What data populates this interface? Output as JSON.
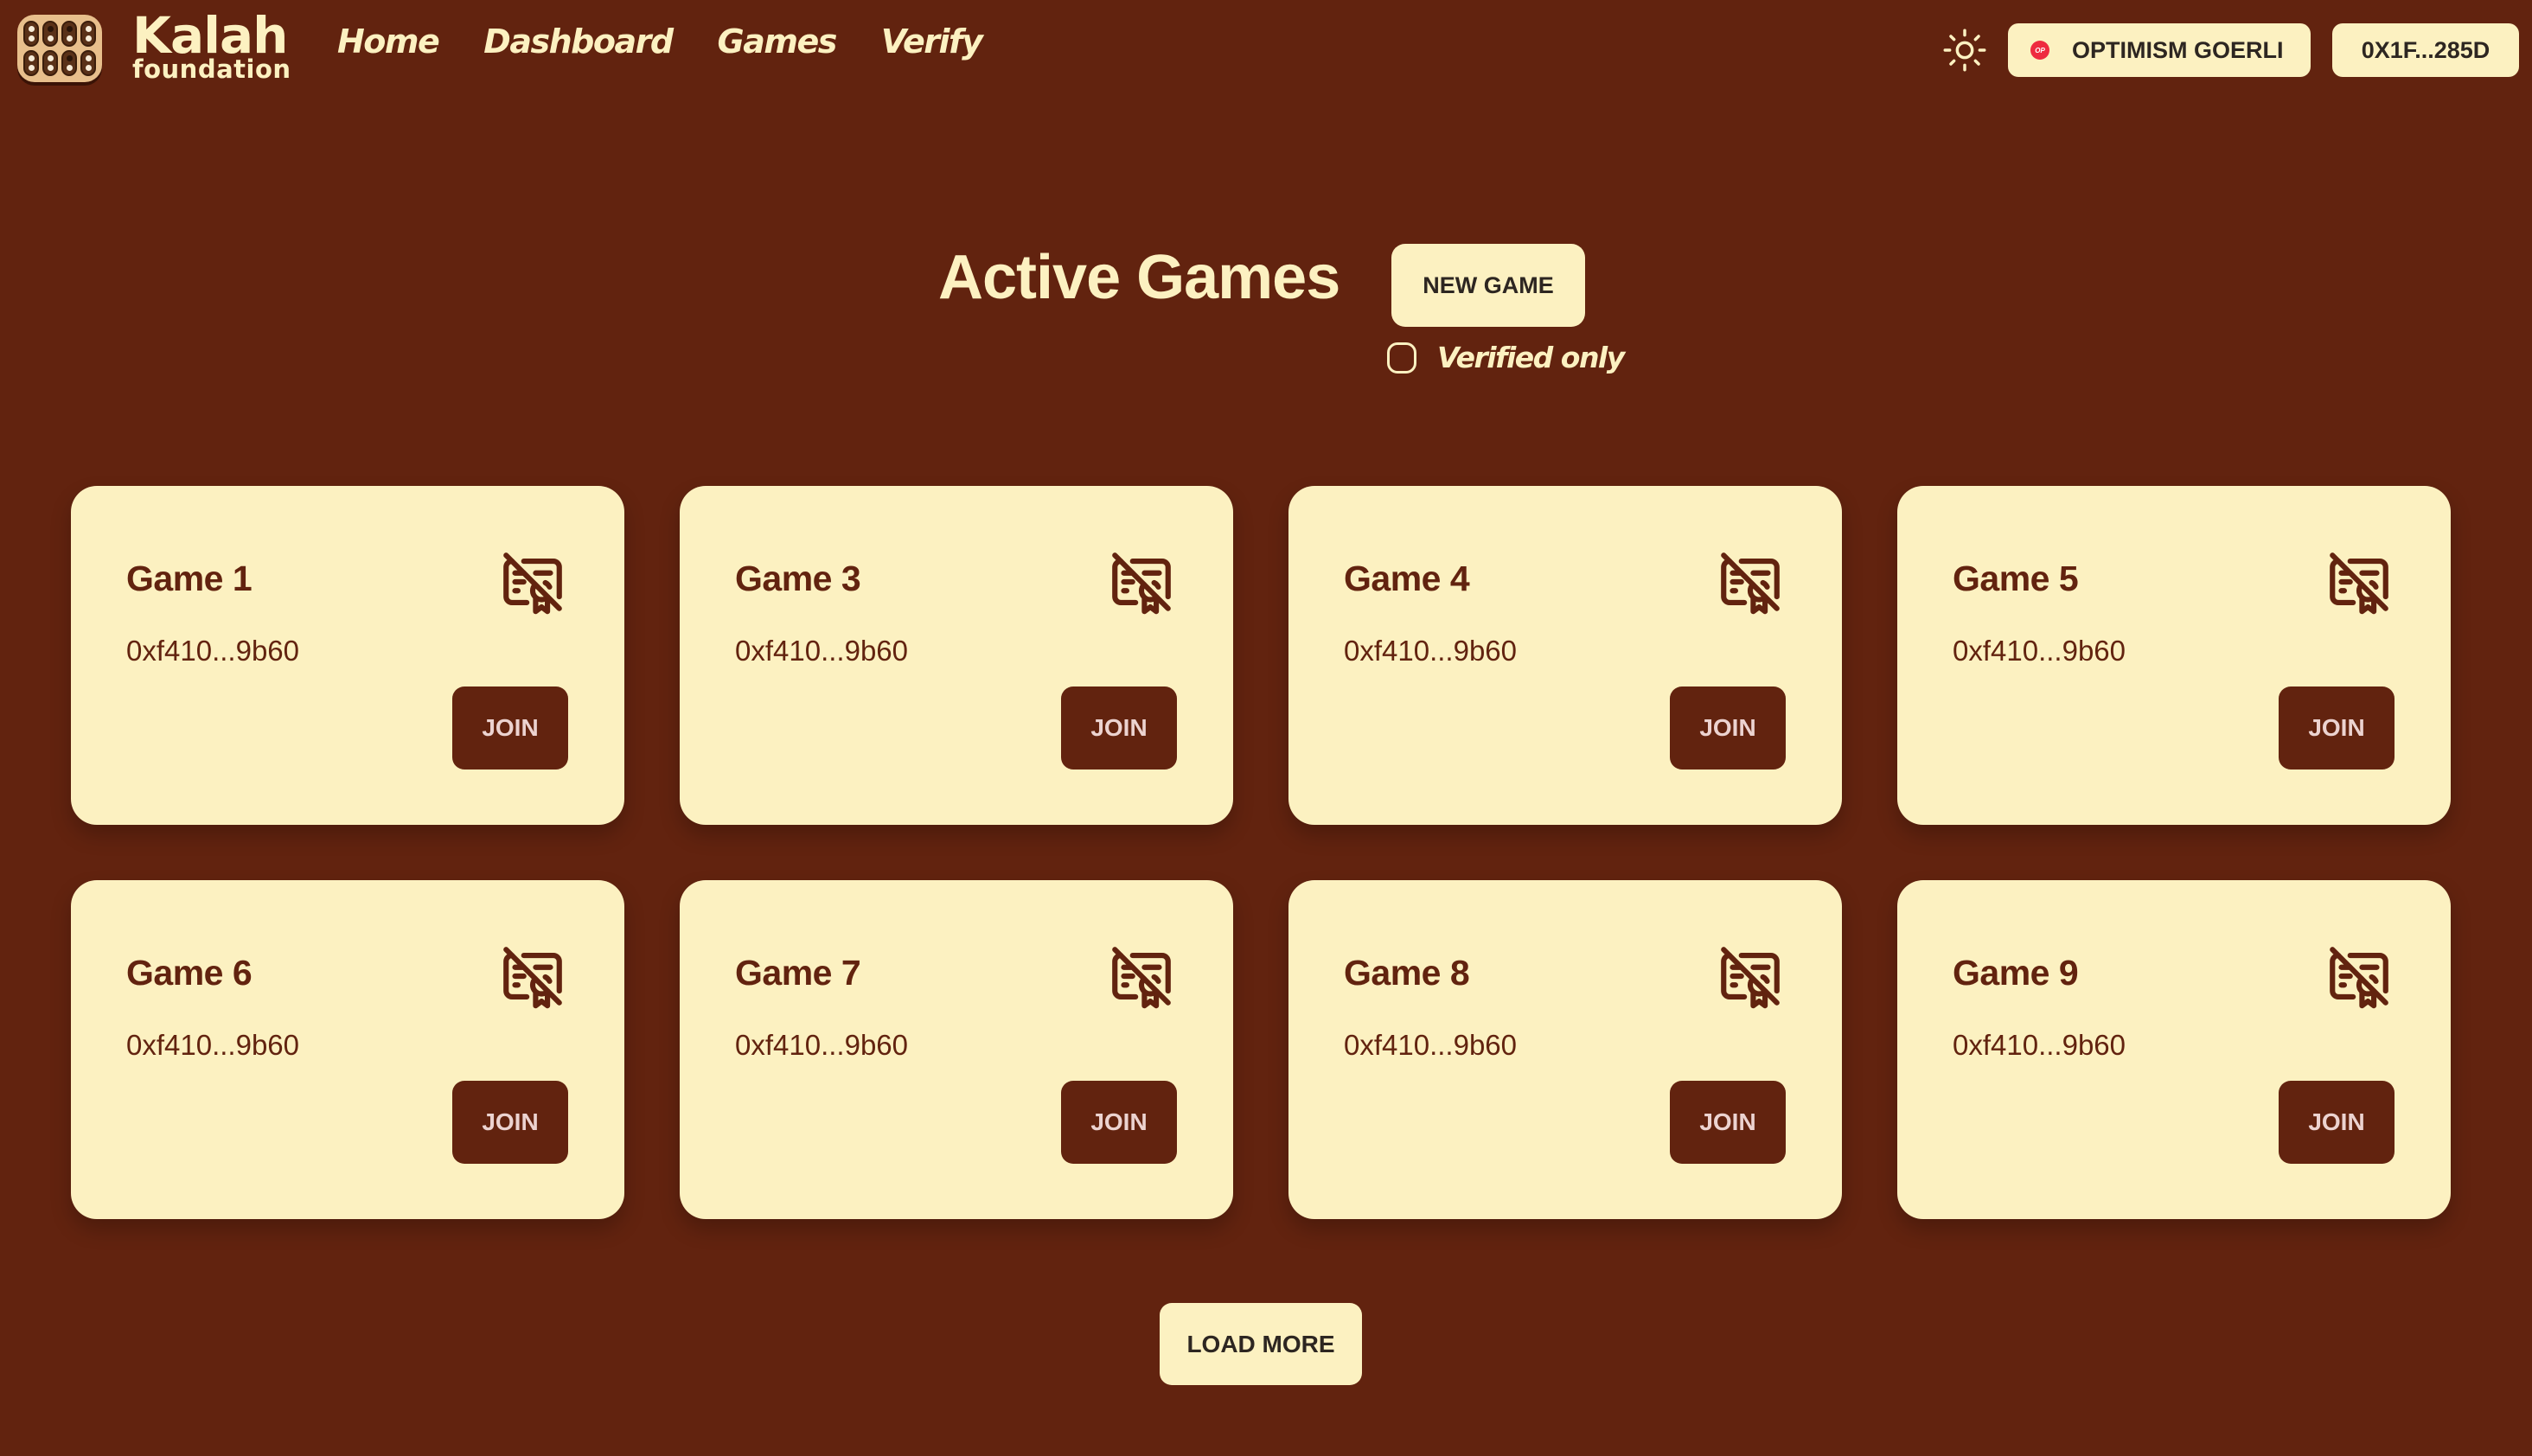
{
  "brand": {
    "title": "Kalah",
    "subtitle": "foundation"
  },
  "nav": {
    "links": [
      {
        "label": "Home"
      },
      {
        "label": "Dashboard"
      },
      {
        "label": "Games"
      },
      {
        "label": "Verify"
      }
    ]
  },
  "header_controls": {
    "theme_icon": "sun-icon",
    "network": {
      "badge": "OP",
      "label": "OPTIMISM GOERLI",
      "badge_color": "#ee2a3f"
    },
    "account": {
      "label": "0X1F...285D"
    }
  },
  "main": {
    "title": "Active Games",
    "new_game_label": "NEW GAME",
    "verified_filter": {
      "label": "Verified only",
      "checked": false
    },
    "games": [
      {
        "title": "Game 1",
        "address": "0xf410...9b60",
        "verified": false,
        "join_label": "JOIN"
      },
      {
        "title": "Game 3",
        "address": "0xf410...9b60",
        "verified": false,
        "join_label": "JOIN"
      },
      {
        "title": "Game 4",
        "address": "0xf410...9b60",
        "verified": false,
        "join_label": "JOIN"
      },
      {
        "title": "Game 5",
        "address": "0xf410...9b60",
        "verified": false,
        "join_label": "JOIN"
      },
      {
        "title": "Game 6",
        "address": "0xf410...9b60",
        "verified": false,
        "join_label": "JOIN"
      },
      {
        "title": "Game 7",
        "address": "0xf410...9b60",
        "verified": false,
        "join_label": "JOIN"
      },
      {
        "title": "Game 8",
        "address": "0xf410...9b60",
        "verified": false,
        "join_label": "JOIN"
      },
      {
        "title": "Game 9",
        "address": "0xf410...9b60",
        "verified": false,
        "join_label": "JOIN"
      }
    ],
    "load_more_label": "LOAD MORE"
  },
  "colors": {
    "background": "#62230f",
    "card": "#fcf1c1",
    "accent_text": "#62230f",
    "button_text_dark": "#2d2621"
  }
}
